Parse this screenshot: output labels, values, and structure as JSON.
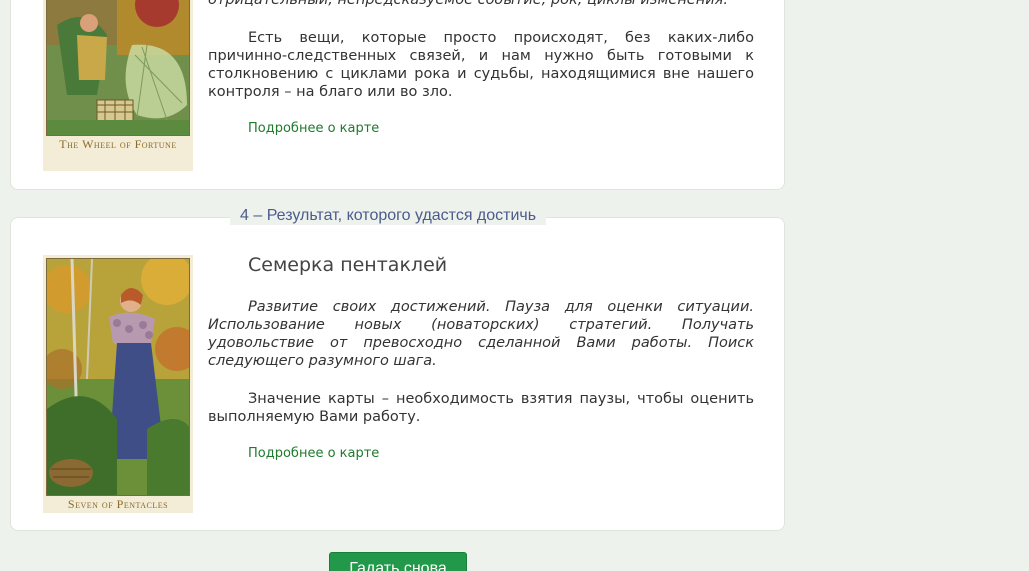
{
  "card_prev": {
    "top_line": "отрицательный, непредсказуемое событие, рок, циклы изменения.",
    "paragraph": "Есть вещи, которые просто происходят, без каких-либо причинно-следственных связей, и нам нужно быть готовыми к столкновению с циклами рока и судьбы, находящимися вне нашего контроля – на благо или во зло.",
    "more_link": "Подробнее о карте",
    "image_caption": "The Wheel of Fortune"
  },
  "section4": {
    "title": "4 – Результат, которого удастся достичь",
    "card_name": "Семерка пентаклей",
    "italic_text": "Развитие своих достижений. Пауза для оценки ситуации. Использование новых (новаторских) стратегий. Получать удовольствие от превосходно сделанной Вами работы. Поиск следующего разумного шага.",
    "meaning_text": "Значение карты – необходимость взятия паузы, чтобы оценить выполняемую Вами работу.",
    "more_link": "Подробнее о карте",
    "image_caption": "Seven of Pentacles"
  },
  "actions": {
    "retry_button": "Гадать снова"
  },
  "colors": {
    "accent_green": "#22984a",
    "link_green": "#1f7a2e",
    "section_title": "#4b5b8c"
  }
}
